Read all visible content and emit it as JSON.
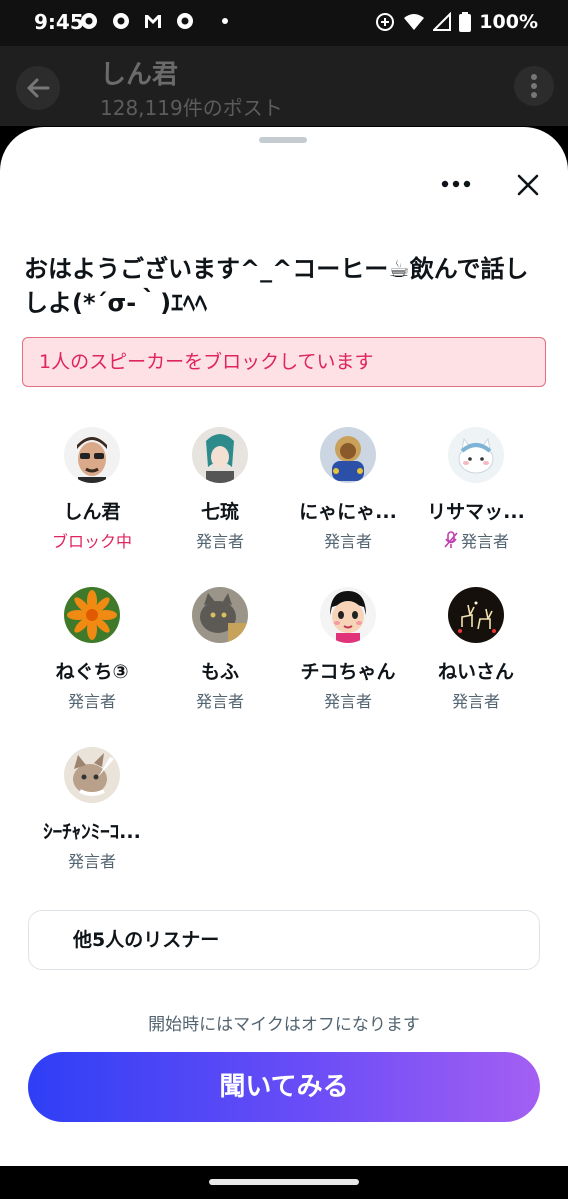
{
  "status_bar": {
    "time": "9:45",
    "battery": "100%",
    "left_icons": [
      "chrome-icon",
      "chrome-icon",
      "gmail-icon",
      "chrome-icon",
      "notification-dot"
    ],
    "right_icons": [
      "data-saver-icon",
      "wifi-icon",
      "signal-icon",
      "battery-icon"
    ]
  },
  "background_header": {
    "title": "しん君",
    "subtitle": "128,119件のポスト"
  },
  "sheet": {
    "title": "おはようございます^_^コーヒー☕飲んで話ししよ(*´σ-｀)ｴﾍﾍ",
    "blocked_banner": "1人のスピーカーをブロックしています",
    "speakers": [
      {
        "name": "しん君",
        "role": "ブロック中",
        "blocked": true,
        "muted": false,
        "avatar": "man-sunglasses"
      },
      {
        "name": "七琉",
        "role": "発言者",
        "blocked": false,
        "muted": false,
        "avatar": "anime-girl"
      },
      {
        "name": "にゃにゃ...",
        "role": "発言者",
        "blocked": false,
        "muted": false,
        "avatar": "toy-figure"
      },
      {
        "name": "リサマッ...",
        "role": "発言者",
        "blocked": false,
        "muted": true,
        "avatar": "white-cat-character"
      },
      {
        "name": "ねぐち③",
        "role": "発言者",
        "blocked": false,
        "muted": false,
        "avatar": "orange-flower"
      },
      {
        "name": "もふ",
        "role": "発言者",
        "blocked": false,
        "muted": false,
        "avatar": "cat-photo"
      },
      {
        "name": "チコちゃん",
        "role": "発言者",
        "blocked": false,
        "muted": false,
        "avatar": "chiko-chan-girl"
      },
      {
        "name": "ねいさん",
        "role": "発言者",
        "blocked": false,
        "muted": false,
        "avatar": "reindeer-lights"
      },
      {
        "name": "ｼｰﾁｬﾝﾐｰｺ...",
        "role": "発言者",
        "blocked": false,
        "muted": false,
        "avatar": "cat-photo"
      }
    ],
    "listeners": "他5人のリスナー",
    "mic_note": "開始時にはマイクはオフになります",
    "listen_button": "聞いてみる"
  },
  "colors": {
    "accent_gradient_start": "#2f3ff5",
    "accent_gradient_end": "#a45ff2",
    "blocked_red": "#e0245e",
    "banner_bg": "#fde1e4"
  }
}
